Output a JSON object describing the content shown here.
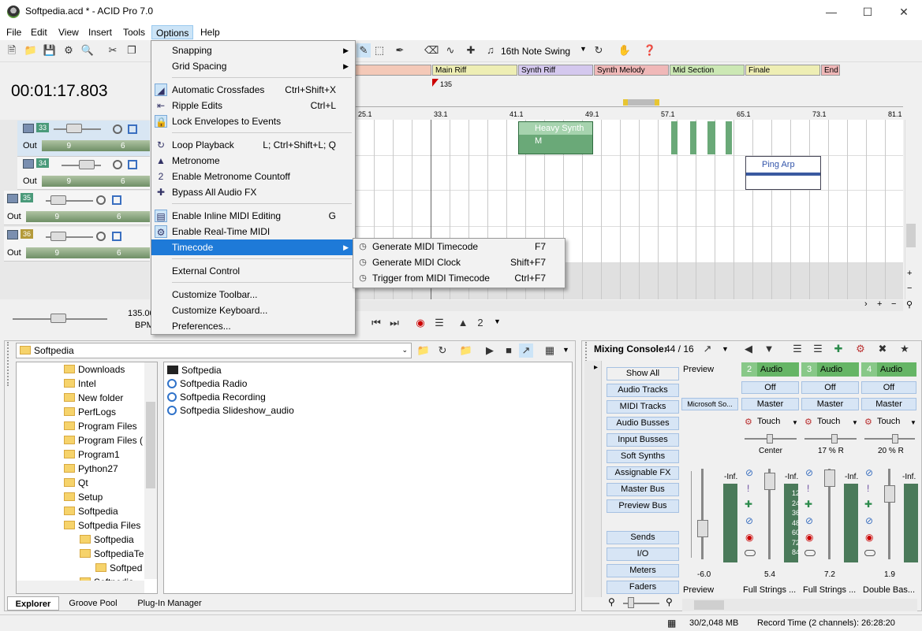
{
  "window": {
    "title": "Softpedia.acd * - ACID Pro 7.0"
  },
  "menubar": [
    "File",
    "Edit",
    "View",
    "Insert",
    "Tools",
    "Options",
    "Help"
  ],
  "toolbar": {
    "swing_label": "16th Note Swing"
  },
  "transport": {
    "time": "00:01:17.803",
    "bpm_value": "135.00",
    "bpm_label": "BPM"
  },
  "tracks": [
    {
      "num": "33",
      "out": "Out",
      "v1": "9",
      "v2": "6"
    },
    {
      "num": "34",
      "out": "Out",
      "v1": "9",
      "v2": "6"
    },
    {
      "num": "35",
      "out": "Out",
      "v1": "9",
      "v2": "6"
    },
    {
      "num": "36",
      "out": "Out",
      "v1": "9",
      "v2": "6"
    }
  ],
  "timeline": {
    "regions": [
      "Main Riff",
      "Synth Riff",
      "Synth Melody",
      "Mid Section",
      "Finale",
      "End"
    ],
    "tempo_marker": "135",
    "ruler": [
      "25.1",
      "33.1",
      "41.1",
      "49.1",
      "57.1",
      "65.1",
      "73.1",
      "81.1"
    ],
    "events": [
      "Heavy Synth M",
      "Ping Arp"
    ]
  },
  "options_menu": {
    "items": [
      {
        "label": "Snapping",
        "submenu": true
      },
      {
        "label": "Grid Spacing",
        "submenu": true
      },
      {
        "label": "Automatic Crossfades",
        "shortcut": "Ctrl+Shift+X"
      },
      {
        "label": "Ripple Edits",
        "shortcut": "Ctrl+L"
      },
      {
        "label": "Lock Envelopes to Events",
        "shortcut": ""
      },
      {
        "label": "Loop Playback",
        "shortcut": "L; Ctrl+Shift+L; Q"
      },
      {
        "label": "Metronome",
        "shortcut": ""
      },
      {
        "label": "Enable Metronome Countoff",
        "shortcut": ""
      },
      {
        "label": "Bypass All Audio FX",
        "shortcut": ""
      },
      {
        "label": "Enable Inline MIDI Editing",
        "shortcut": "G"
      },
      {
        "label": "Enable Real-Time MIDI",
        "shortcut": ""
      },
      {
        "label": "Timecode",
        "submenu": true
      },
      {
        "label": "External Control",
        "shortcut": ""
      },
      {
        "label": "Customize Toolbar...",
        "shortcut": ""
      },
      {
        "label": "Customize Keyboard...",
        "shortcut": ""
      },
      {
        "label": "Preferences...",
        "shortcut": ""
      }
    ]
  },
  "timecode_submenu": {
    "items": [
      {
        "label": "Generate MIDI Timecode",
        "shortcut": "F7"
      },
      {
        "label": "Generate MIDI Clock",
        "shortcut": "Shift+F7"
      },
      {
        "label": "Trigger from MIDI Timecode",
        "shortcut": "Ctrl+F7"
      }
    ]
  },
  "explorer": {
    "path": "Softpedia",
    "tree": [
      "Downloads",
      "Intel",
      "New folder",
      "PerfLogs",
      "Program Files",
      "Program Files (",
      "Program1",
      "Python27",
      "Qt",
      "Setup",
      "Softpedia",
      "Softpedia Files",
      "Softpedia",
      "SoftpediaTe",
      "Softped",
      "Softpedia"
    ],
    "files": [
      "Softpedia",
      "Softpedia Radio",
      "Softpedia Recording",
      "Softpedia Slideshow_audio"
    ],
    "tabs": [
      "Explorer",
      "Groove Pool",
      "Plug-In Manager"
    ]
  },
  "mixer": {
    "title": "Mixing Console:",
    "count": "44 / 16",
    "buttons": [
      "Show All",
      "Audio Tracks",
      "MIDI Tracks",
      "Audio Busses",
      "Input Busses",
      "Soft Synths",
      "Assignable FX",
      "Master Bus",
      "Preview Bus"
    ],
    "buttons2": [
      "Sends",
      "I/O",
      "Meters",
      "Faders"
    ],
    "preview": {
      "label": "Preview",
      "device": "Microsoft So...",
      "level": "-6.0",
      "footer": "Preview"
    },
    "channels": [
      {
        "num": "2",
        "name": "Audio",
        "off": "Off",
        "master": "Master",
        "touch": "Touch",
        "pan": "Center",
        "inf": "-Inf.",
        "level": "5.4",
        "footer": "Full Strings ..."
      },
      {
        "num": "3",
        "name": "Audio",
        "off": "Off",
        "master": "Master",
        "touch": "Touch",
        "pan": "17 % R",
        "inf": "-Inf.",
        "level": "7.2",
        "footer": "Full Strings ..."
      },
      {
        "num": "4",
        "name": "Audio",
        "off": "Off",
        "master": "Master",
        "touch": "Touch",
        "pan": "20 % R",
        "inf": "-Inf.",
        "level": "1.9",
        "footer": "Double Bas..."
      }
    ],
    "meter_scale": [
      "12",
      "24",
      "36",
      "48",
      "60",
      "72",
      "84"
    ]
  },
  "status": {
    "memory": "30/2,048 MB",
    "record": "Record Time (2 channels): 26:28:20"
  }
}
